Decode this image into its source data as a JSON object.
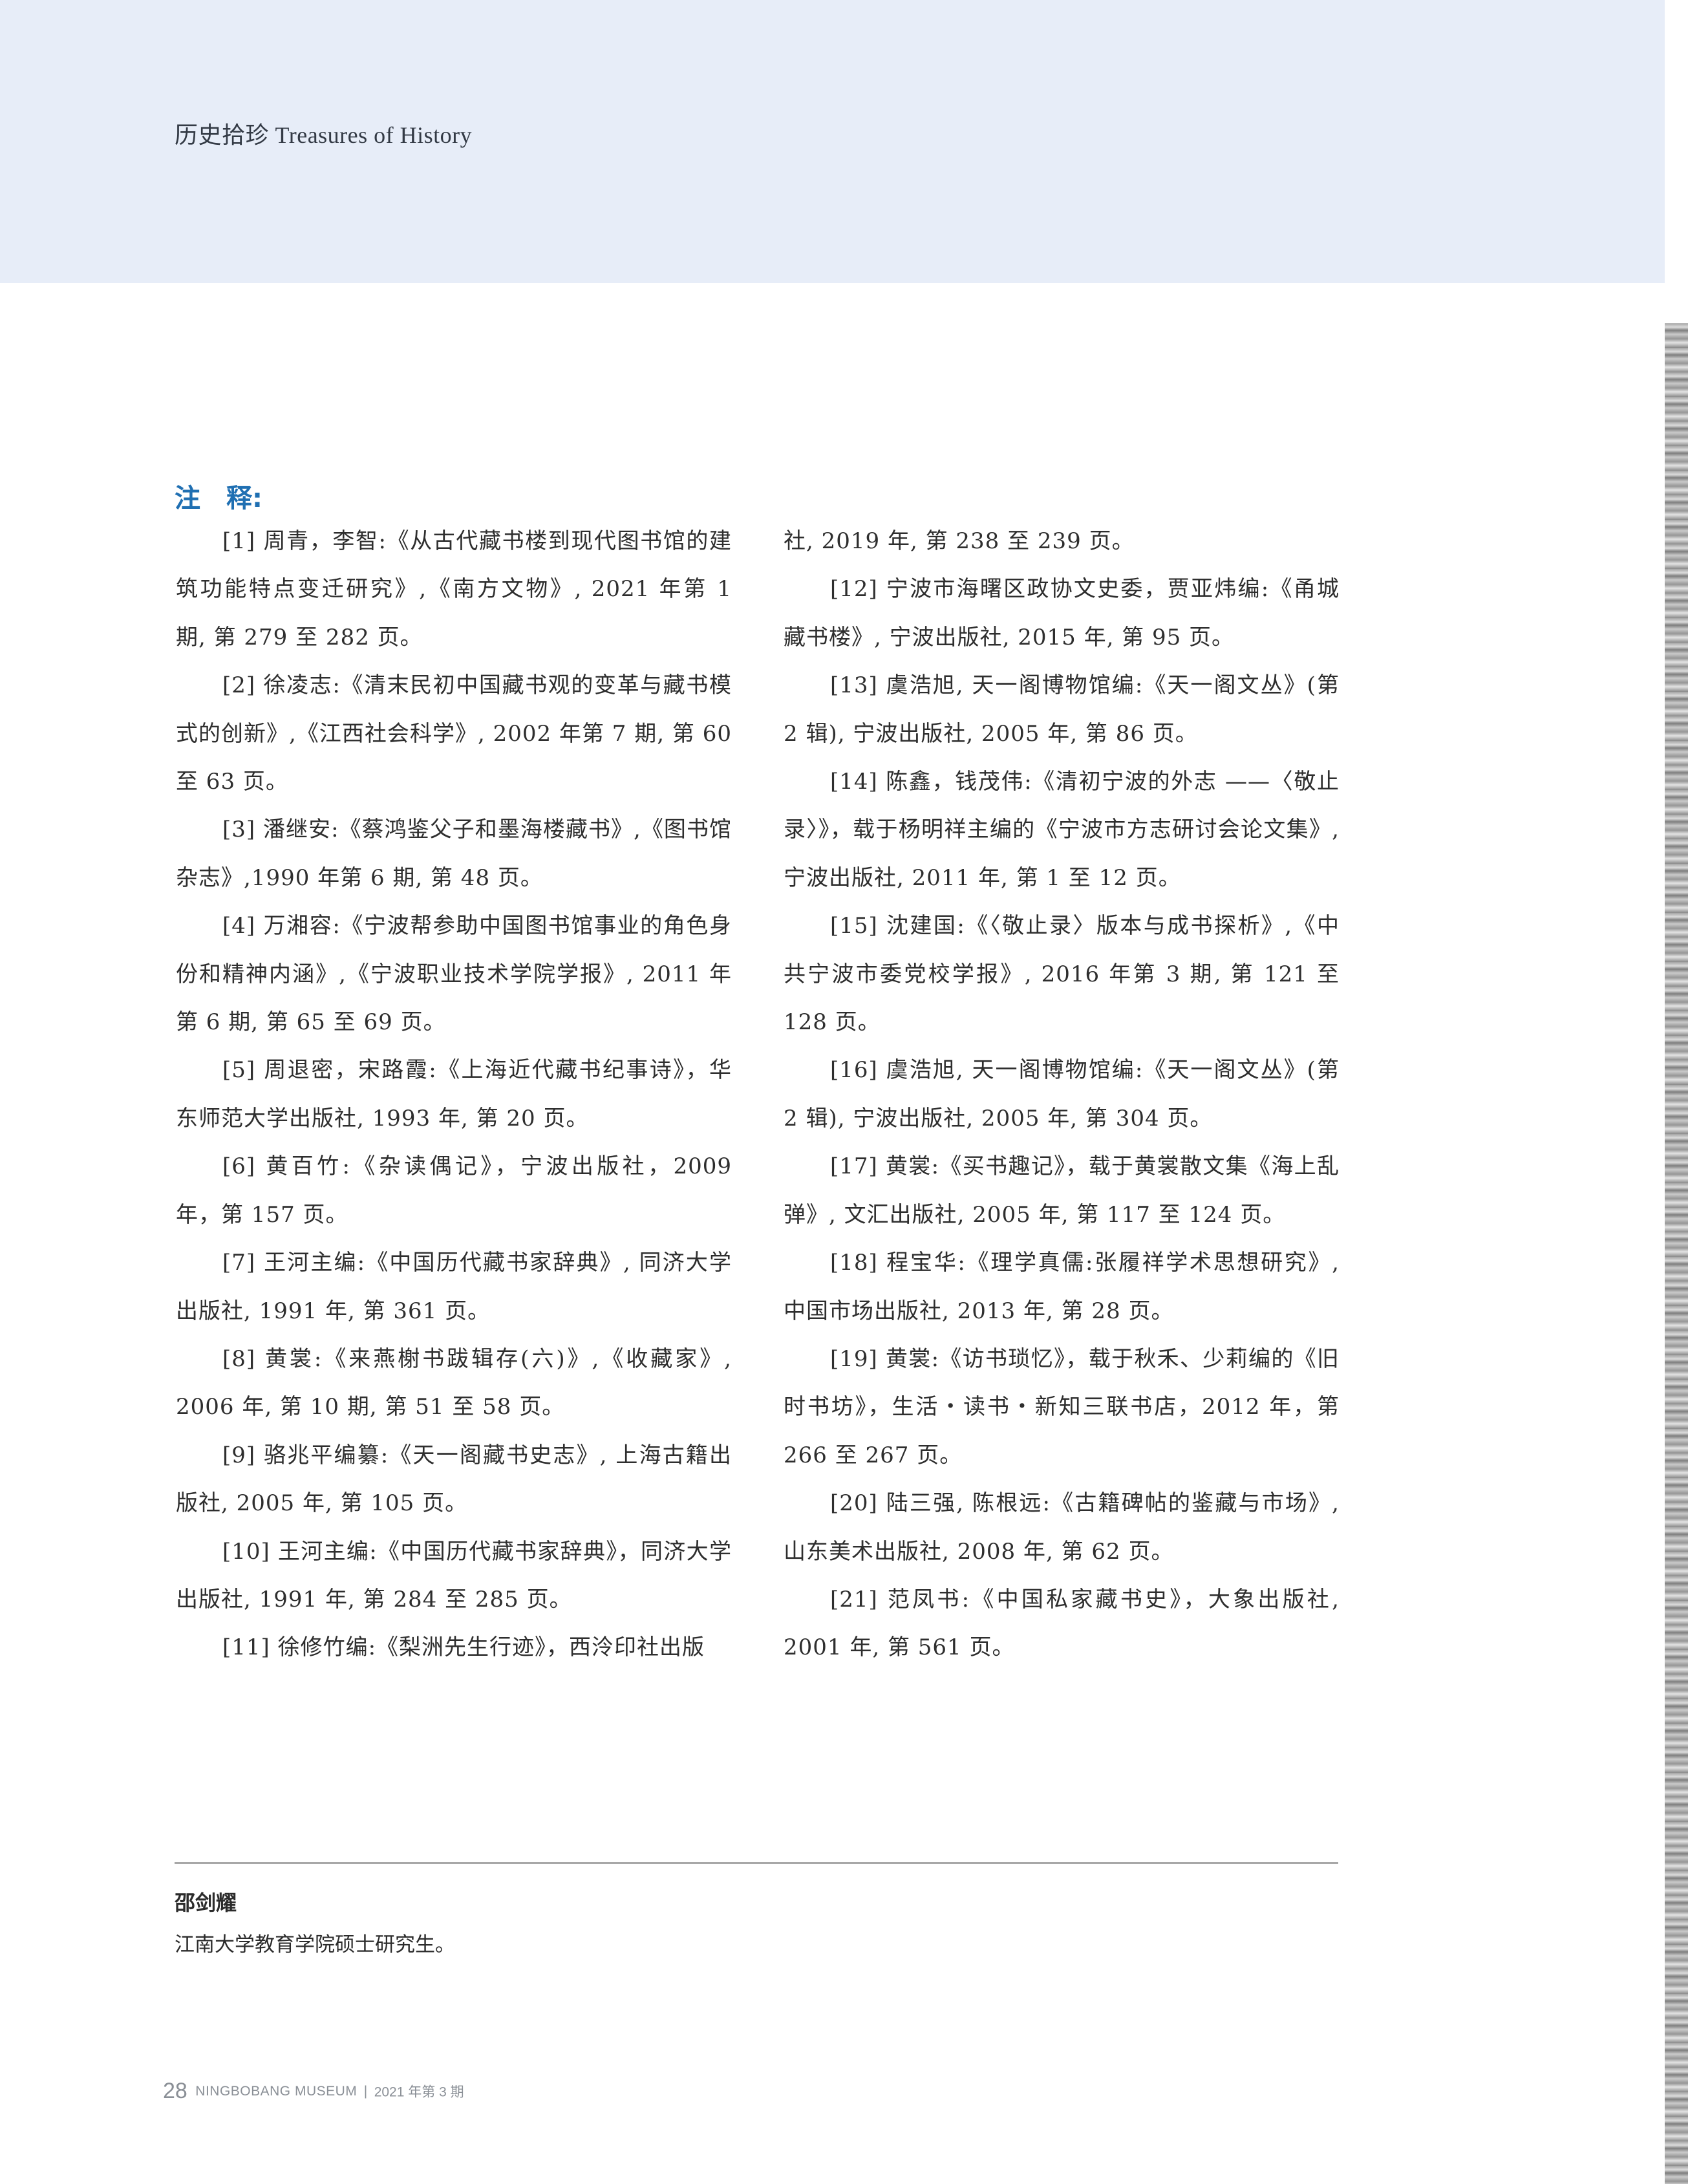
{
  "header": {
    "section_label": "历史拾珍 Treasures of History"
  },
  "notes_title": "注　释:",
  "notes_left": [
    {
      "text": "[1] 周青，李智:《从古代藏书楼到现代图书馆的建筑功能特点变迁研究》,《南方文物》, 2021 年第 1 期, 第 279 至 282 页。",
      "indent": true
    },
    {
      "text": "[2] 徐凌志:《清末民初中国藏书观的变革与藏书模式的创新》,《江西社会科学》, 2002 年第 7 期, 第 60 至 63 页。",
      "indent": true
    },
    {
      "text": "[3] 潘继安:《蔡鸿鉴父子和墨海楼藏书》,《图书馆杂志》,1990 年第 6 期, 第 48 页。",
      "indent": true
    },
    {
      "text": "[4] 万湘容:《宁波帮参助中国图书馆事业的角色身份和精神内涵》,《宁波职业技术学院学报》, 2011 年第 6 期, 第 65 至 69 页。",
      "indent": true
    },
    {
      "text": "[5] 周退密，宋路霞:《上海近代藏书纪事诗》，华东师范大学出版社, 1993 年, 第 20 页。",
      "indent": true
    },
    {
      "text": "[6] 黄百竹:《杂读偶记》，宁波出版社，2009 年，第 157 页。",
      "indent": true
    },
    {
      "text": "[7] 王河主编:《中国历代藏书家辞典》, 同济大学出版社, 1991 年, 第 361 页。",
      "indent": true
    },
    {
      "text": "[8] 黄裳:《来燕榭书跋辑存(六)》,《收藏家》, 2006 年, 第 10 期, 第 51 至 58 页。",
      "indent": true
    },
    {
      "text": "[9] 骆兆平编纂:《天一阁藏书史志》, 上海古籍出版社, 2005 年, 第 105 页。",
      "indent": true
    },
    {
      "text": "[10] 王河主编:《中国历代藏书家辞典》，同济大学出版社, 1991 年, 第 284 至 285 页。",
      "indent": true
    },
    {
      "text": "[11] 徐修竹编:《梨洲先生行迹》，西泠印社出版",
      "indent": true
    }
  ],
  "notes_right": [
    {
      "text": "社, 2019 年, 第 238 至 239 页。",
      "indent": false
    },
    {
      "text": "[12] 宁波市海曙区政协文史委，贾亚炜编:《甬城藏书楼》, 宁波出版社, 2015 年, 第 95 页。",
      "indent": true
    },
    {
      "text": "[13] 虞浩旭, 天一阁博物馆编:《天一阁文丛》(第 2 辑), 宁波出版社, 2005 年, 第 86 页。",
      "indent": true
    },
    {
      "text": "[14] 陈鑫，钱茂伟:《清初宁波的外志 ——〈敬止录〉》，载于杨明祥主编的《宁波市方志研讨会论文集》, 宁波出版社, 2011 年, 第 1 至 12 页。",
      "indent": true
    },
    {
      "text": "[15] 沈建国:《〈敬止录〉版本与成书探析》,《中共宁波市委党校学报》, 2016 年第 3 期, 第 121 至 128 页。",
      "indent": true
    },
    {
      "text": "[16] 虞浩旭, 天一阁博物馆编:《天一阁文丛》(第 2 辑), 宁波出版社, 2005 年, 第 304 页。",
      "indent": true
    },
    {
      "text": "[17] 黄裳:《买书趣记》，载于黄裳散文集《海上乱弹》, 文汇出版社, 2005 年, 第 117 至 124 页。",
      "indent": true
    },
    {
      "text": "[18] 程宝华:《理学真儒:张履祥学术思想研究》, 中国市场出版社, 2013 年, 第 28 页。",
      "indent": true
    },
    {
      "text": "[19] 黄裳:《访书琐忆》，载于秋禾、少莉编的《旧时书坊》，生活・读书・新知三联书店，2012 年，第 266 至 267 页。",
      "indent": true
    },
    {
      "text": "[20] 陆三强, 陈根远:《古籍碑帖的鉴藏与市场》, 山东美术出版社, 2008 年, 第 62 页。",
      "indent": true
    },
    {
      "text": "[21] 范凤书:《中国私家藏书史》，大象出版社, 2001 年, 第 561 页。",
      "indent": true
    }
  ],
  "author": {
    "name": "邵剑耀",
    "bio": "江南大学教育学院硕士研究生。"
  },
  "footer": {
    "page_number": "28",
    "journal": "NINGBOBANG MUSEUM",
    "separator": "|",
    "issue": "2021 年第 3 期"
  },
  "colors": {
    "header_band": "#e7edf8",
    "notes_title": "#1f6fb2",
    "rule": "#a8a8a8",
    "footer_text": "#8a8f96"
  }
}
